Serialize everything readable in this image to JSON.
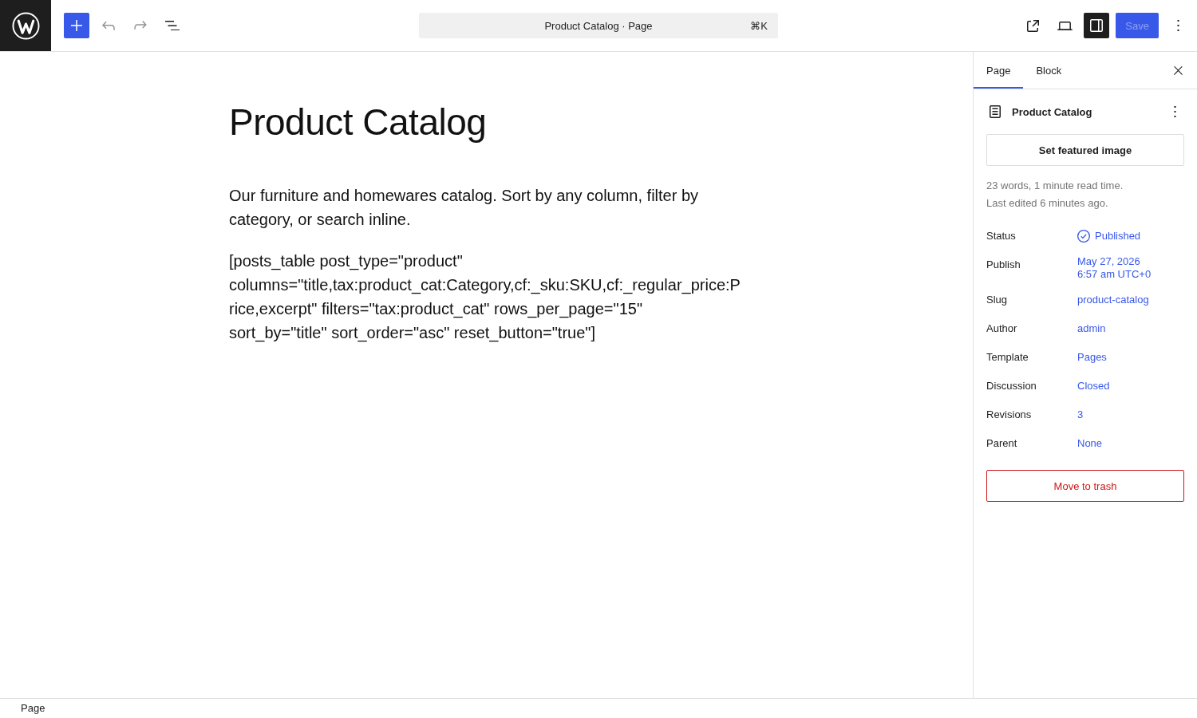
{
  "toolbar": {
    "undo": {
      "disabled": true
    },
    "redo": {
      "disabled": true
    },
    "command_bar": {
      "title": "Product Catalog · Page",
      "shortcut": "⌘K"
    },
    "settings_toggle": {
      "pressed": true
    },
    "save": {
      "label": "Save",
      "disabled": true
    }
  },
  "editor": {
    "title": "Product Catalog",
    "paragraphs": [
      "Our furniture and homewares catalog. Sort by any column, filter by category, or search inline.",
      "[posts_table post_type=\"product\" columns=\"title,tax:product_cat:Category,cf:_sku:SKU,cf:_regular_price:Price,excerpt\" filters=\"tax:product_cat\" rows_per_page=\"15\" sort_by=\"title\" sort_order=\"asc\" reset_button=\"true\"]"
    ]
  },
  "sidebar": {
    "tabs": [
      {
        "label": "Page",
        "selected": true
      },
      {
        "label": "Block",
        "selected": false
      }
    ],
    "document": {
      "title": "Product Catalog"
    },
    "featured_image_button": "Set featured image",
    "stats": [
      "23 words, 1 minute read time.",
      "Last edited 6 minutes ago."
    ],
    "fields": [
      {
        "label": "Status",
        "value": "Published",
        "kind": "status"
      },
      {
        "label": "Publish",
        "value": "May 27, 2026 6:57 am UTC+0",
        "kind": "link"
      },
      {
        "label": "Slug",
        "value": "product-catalog",
        "kind": "link"
      },
      {
        "label": "Author",
        "value": "admin",
        "kind": "link"
      },
      {
        "label": "Template",
        "value": "Pages",
        "kind": "link"
      },
      {
        "label": "Discussion",
        "value": "Closed",
        "kind": "link"
      },
      {
        "label": "Revisions",
        "value": "3",
        "kind": "link"
      },
      {
        "label": "Parent",
        "value": "None",
        "kind": "link"
      }
    ],
    "trash_button": "Move to trash"
  },
  "status_bar": {
    "breadcrumb": "Page"
  }
}
